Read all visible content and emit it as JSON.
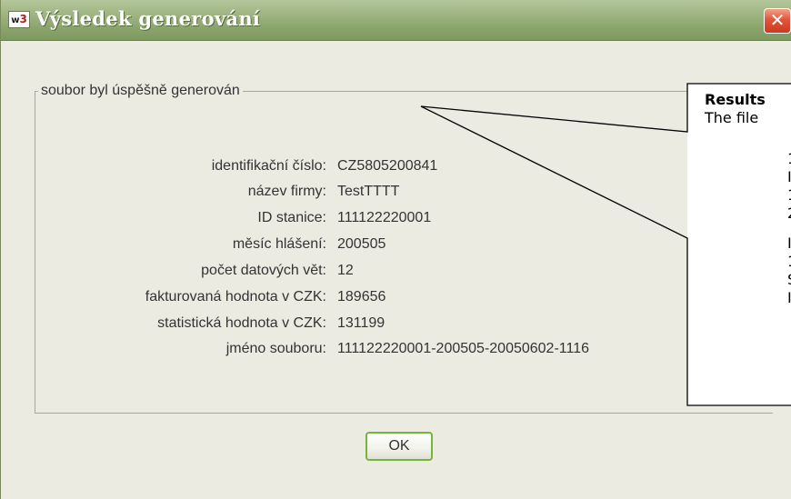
{
  "window": {
    "title": "Výsledek generování",
    "icon_text_a": "w",
    "icon_text_b": "3",
    "close_glyph": "✕"
  },
  "group": {
    "title": "soubor byl úspěšně generován"
  },
  "fields": [
    {
      "label": "identifikační číslo:",
      "value": "CZ5805200841"
    },
    {
      "label": "název firmy:",
      "value": "TestTTTT"
    },
    {
      "label": "ID stanice:",
      "value": "111122220001"
    },
    {
      "label": "měsíc hlášení:",
      "value": "200505"
    },
    {
      "label": "počet datových vět:",
      "value": "12"
    },
    {
      "label": "fakturovaná hodnota v CZK:",
      "value": "189656"
    },
    {
      "label": "statistická hodnota v CZK:",
      "value": "131199"
    },
    {
      "label": "jméno souboru:",
      "value": "111122220001-200505-20050602-1116"
    }
  ],
  "buttons": {
    "ok_label": "OK"
  },
  "callout": {
    "title": "Results",
    "line1": "The file",
    "fragments": [
      "1",
      "I",
      "1",
      "2",
      "I",
      "1",
      "S",
      "I"
    ]
  },
  "colors": {
    "titlebar": "#9fb583",
    "close": "#e2543a",
    "ok_border": "#72b63c",
    "window_bg": "#ecebe2"
  }
}
